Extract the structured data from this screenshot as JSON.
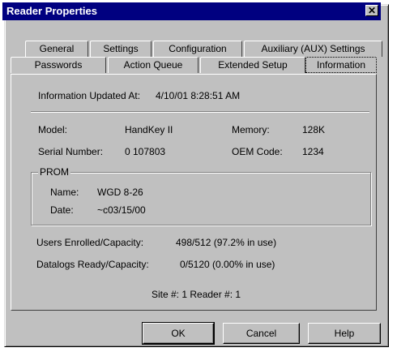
{
  "window": {
    "title": "Reader Properties",
    "close_glyph": "✕"
  },
  "tabs_row1": [
    "General",
    "Settings",
    "Configuration",
    "Auxiliary (AUX) Settings"
  ],
  "tabs_row2": [
    "Passwords",
    "Action Queue",
    "Extended Setup",
    "Information"
  ],
  "info": {
    "updated_label": "Information Updated At:",
    "updated_value": "4/10/01 8:28:51 AM",
    "model_label": "Model:",
    "model_value": "HandKey II",
    "memory_label": "Memory:",
    "memory_value": "128K",
    "serial_label": "Serial Number:",
    "serial_value": "0 107803",
    "oem_label": "OEM Code:",
    "oem_value": "1234",
    "prom": {
      "title": "PROM",
      "name_label": "Name:",
      "name_value": "WGD 8-26",
      "date_label": "Date:",
      "date_value": "~c03/15/00"
    },
    "users_label": "Users Enrolled/Capacity:",
    "users_value": "498/512 (97.2% in use)",
    "datalogs_label": "Datalogs Ready/Capacity:",
    "datalogs_value": "0/5120 (0.00% in use)",
    "site_reader": "Site #: 1  Reader #: 1"
  },
  "buttons": {
    "ok": "OK",
    "cancel": "Cancel",
    "help": "Help"
  }
}
